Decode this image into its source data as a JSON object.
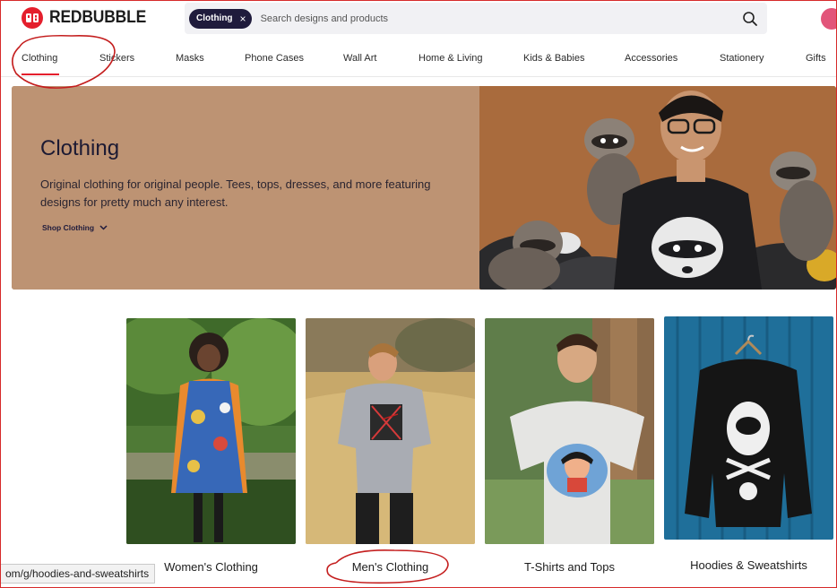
{
  "brand": {
    "name": "REDBUBBLE",
    "accent": "#e41f2d",
    "ink": "#1f1b3c"
  },
  "search": {
    "chip_label": "Clothing",
    "placeholder": "Search designs and products"
  },
  "nav": {
    "items": [
      {
        "label": "Clothing"
      },
      {
        "label": "Stickers"
      },
      {
        "label": "Masks"
      },
      {
        "label": "Phone Cases"
      },
      {
        "label": "Wall Art"
      },
      {
        "label": "Home & Living"
      },
      {
        "label": "Kids & Babies"
      },
      {
        "label": "Accessories"
      },
      {
        "label": "Stationery"
      },
      {
        "label": "Gifts"
      }
    ]
  },
  "hero": {
    "title": "Clothing",
    "description": "Original clothing for original people. Tees, tops, dresses, and more featuring designs for pretty much any interest.",
    "cta": "Shop Clothing"
  },
  "categories": [
    {
      "label": "Women's Clothing"
    },
    {
      "label": "Men's Clothing"
    },
    {
      "label": "T-Shirts and Tops"
    },
    {
      "label": "Hoodies & Sweatshirts"
    }
  ],
  "status_bar": {
    "url": "om/g/hoodies-and-sweatshirts"
  }
}
